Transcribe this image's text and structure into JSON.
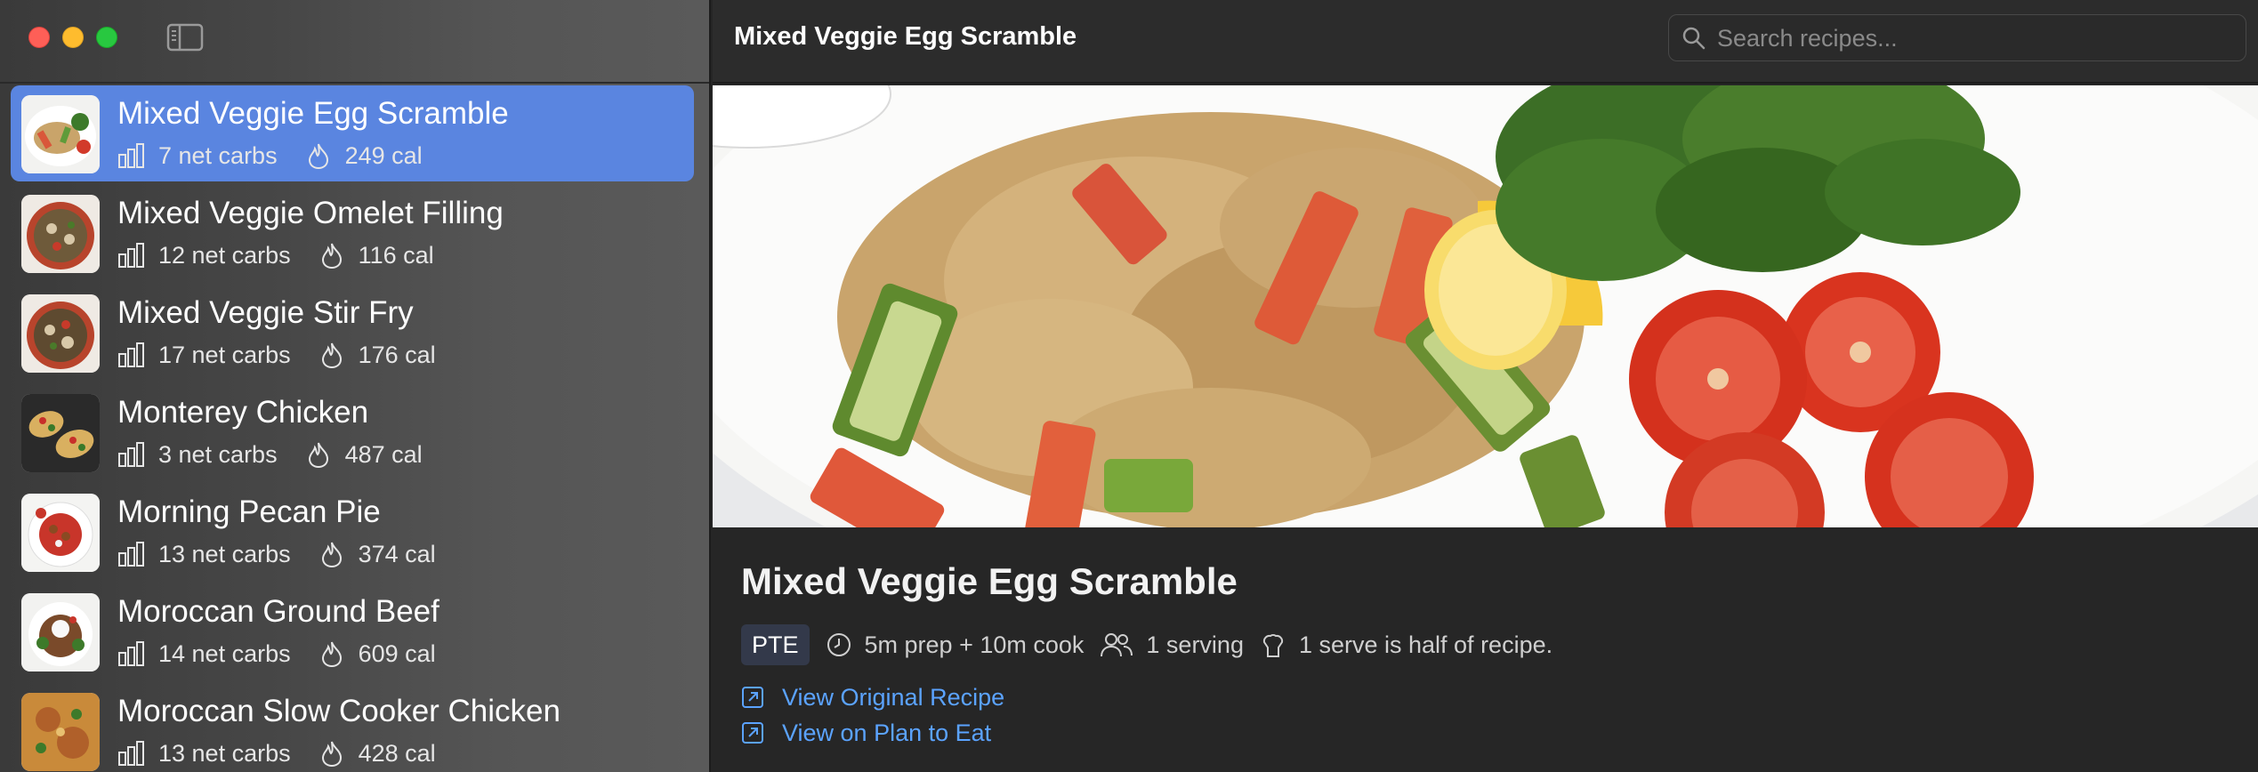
{
  "window": {
    "title": "Mixed Veggie Egg Scramble"
  },
  "search": {
    "placeholder": "Search recipes..."
  },
  "sidebar": {
    "recipes": [
      {
        "title": "Mixed Veggie Egg Scramble",
        "carbs": "7 net carbs",
        "cal": "249 cal",
        "selected": true
      },
      {
        "title": "Mixed Veggie Omelet Filling",
        "carbs": "12 net carbs",
        "cal": "116 cal",
        "selected": false
      },
      {
        "title": "Mixed Veggie Stir Fry",
        "carbs": "17 net carbs",
        "cal": "176 cal",
        "selected": false
      },
      {
        "title": "Monterey Chicken",
        "carbs": "3 net carbs",
        "cal": "487 cal",
        "selected": false
      },
      {
        "title": "Morning Pecan Pie",
        "carbs": "13 net carbs",
        "cal": "374 cal",
        "selected": false
      },
      {
        "title": "Moroccan Ground Beef",
        "carbs": "14 net carbs",
        "cal": "609 cal",
        "selected": false
      },
      {
        "title": "Moroccan Slow Cooker Chicken",
        "carbs": "13 net carbs",
        "cal": "428 cal",
        "selected": false
      }
    ]
  },
  "detail": {
    "title": "Mixed Veggie Egg Scramble",
    "badge": "PTE",
    "time": "5m prep + 10m cook",
    "servings": "1 serving",
    "serving_note": "1 serve is half of recipe.",
    "links": {
      "original": "View Original Recipe",
      "plan_to_eat": "View on Plan to Eat"
    }
  },
  "colors": {
    "selection": "#5a85e0",
    "link": "#5ba3ff",
    "close": "#fe5f57",
    "minimize": "#febc2e",
    "zoom": "#28c840"
  },
  "icons": {
    "carbs": "bar-chart-icon",
    "calories": "flame-icon",
    "time": "clock-icon",
    "servings": "people-icon",
    "note": "chef-hat-icon",
    "link": "external-link-icon"
  }
}
